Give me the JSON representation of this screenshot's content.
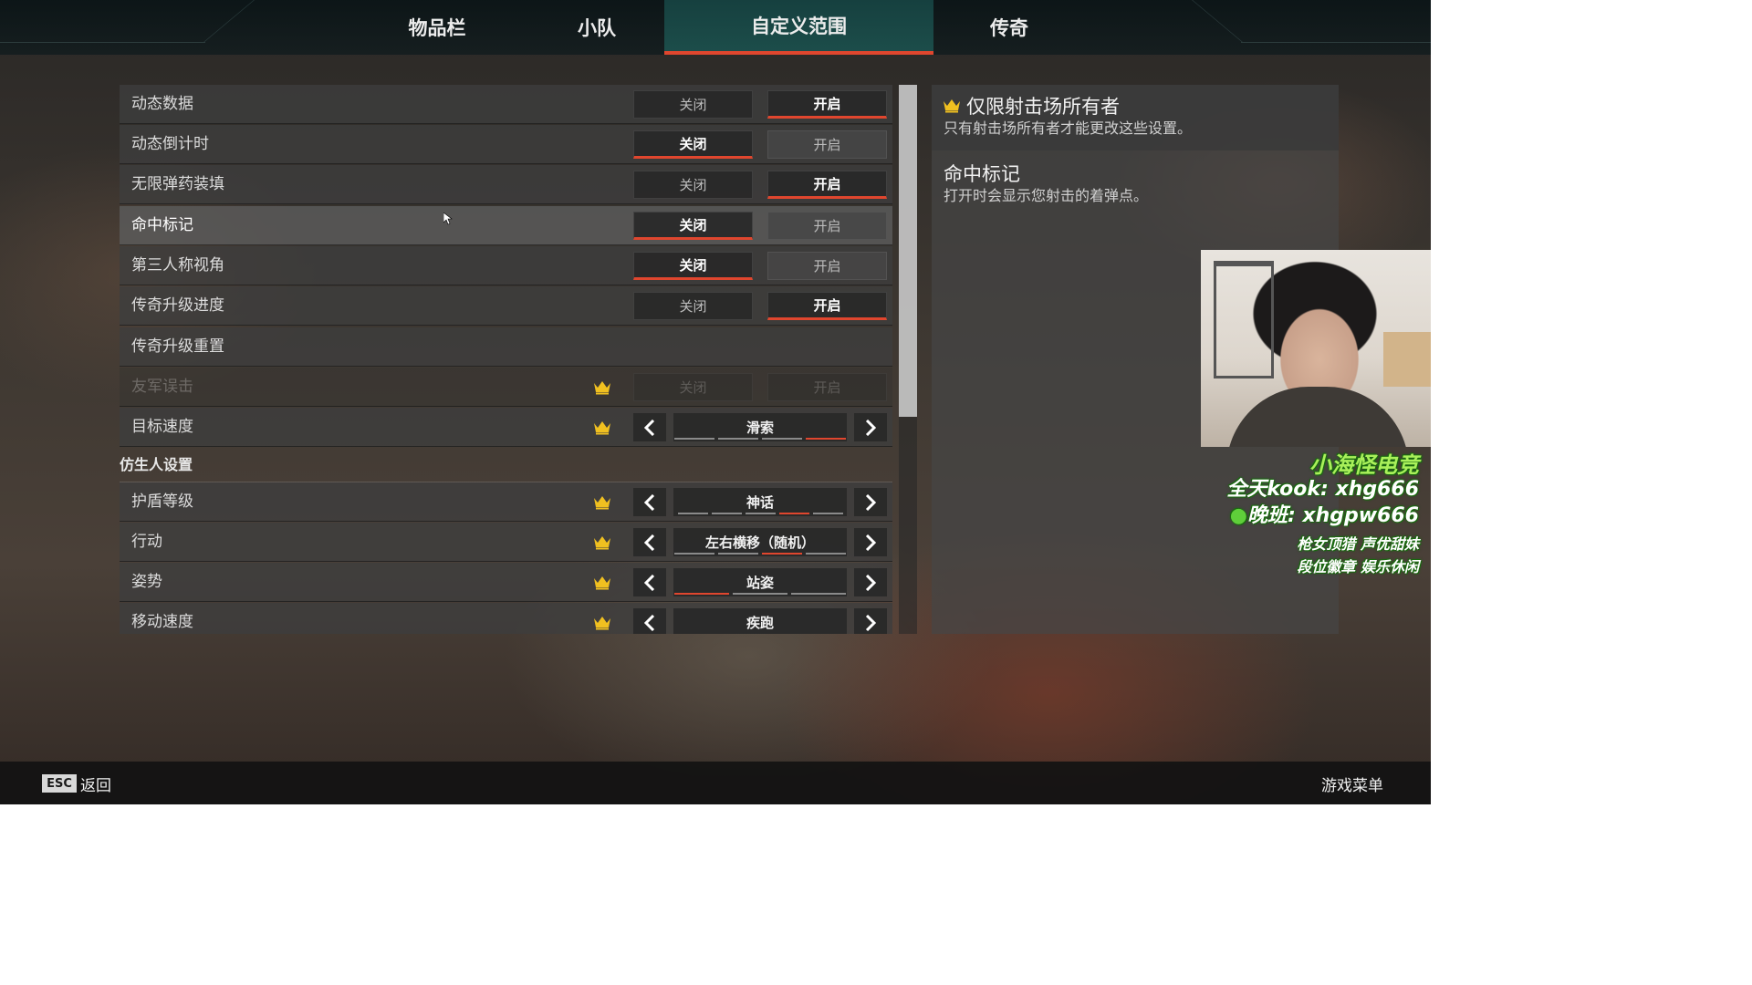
{
  "tabs": [
    {
      "label": "物品栏",
      "active": false
    },
    {
      "label": "小队",
      "active": false
    },
    {
      "label": "自定义范围",
      "active": true
    },
    {
      "label": "传奇",
      "active": false
    }
  ],
  "toggle_labels": {
    "off": "关闭",
    "on": "开启"
  },
  "settings": [
    {
      "label": "动态数据",
      "state": "on"
    },
    {
      "label": "动态倒计时",
      "state": "off"
    },
    {
      "label": "无限弹药装填",
      "state": "on"
    },
    {
      "label": "命中标记",
      "state": "off"
    },
    {
      "label": "第三人称视角",
      "state": "off"
    },
    {
      "label": "传奇升级进度",
      "state": "on"
    },
    {
      "label": "传奇升级重置"
    },
    {
      "label": "友军误击",
      "locked": true,
      "disabled": true
    },
    {
      "label": "目标速度",
      "locked": true,
      "value": "滑索"
    }
  ],
  "section": {
    "label": "仿生人设置"
  },
  "dummy_settings": [
    {
      "label": "护盾等级",
      "value": "神话"
    },
    {
      "label": "行动",
      "value": "左右横移（随机）"
    },
    {
      "label": "姿势",
      "value": "站姿"
    },
    {
      "label": "移动速度",
      "value": "疾跑"
    }
  ],
  "info": {
    "owner_title": "仅限射击场所有者",
    "owner_desc": "只有射击场所有者才能更改这些设置。",
    "item_title": "命中标记",
    "item_desc": "打开时会显示您射击的着弹点。"
  },
  "overlay": {
    "name": "小海怪电竞",
    "kook": "全天kook: xhg666",
    "wechat": "晚班: xhgpw666",
    "tags1": "枪女顶猎 声优甜妹",
    "tags2": "段位徽章 娱乐休闲"
  },
  "footer": {
    "esc_key": "ESC",
    "back": "返回",
    "menu": "游戏菜单"
  },
  "colors": {
    "accent": "#e0462e",
    "crown": "#f0c020",
    "active_tab": "#1c4d4a"
  }
}
